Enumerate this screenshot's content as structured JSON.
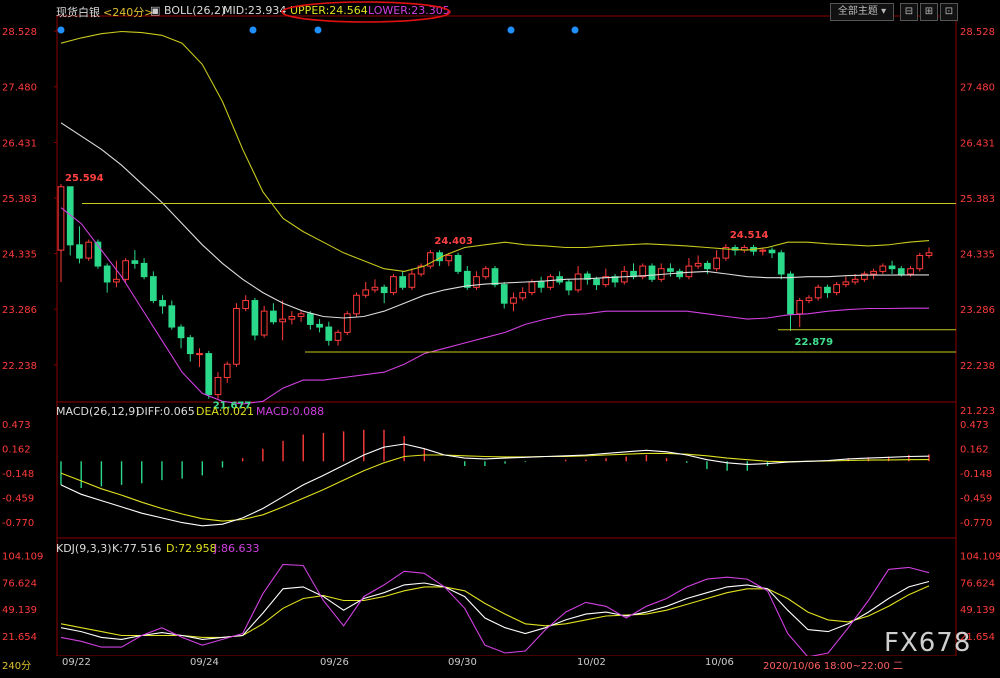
{
  "header": {
    "symbol": "现货白银",
    "period": "<240分>",
    "indicator": "BOLL(26,2)",
    "mid": "MID:23.934",
    "upper": "UPPER:24.564",
    "lower": "LOWER:23.305",
    "theme_button": "全部主题",
    "period_bottom": "240分"
  },
  "colors": {
    "candle_up": "#ff3b3b",
    "candle_down": "#2bd98a",
    "boll_upper": "#c8c81e",
    "boll_mid": "#dddddd",
    "boll_lower": "#d040e0",
    "dea": "#e0e020",
    "diff": "#ffffff",
    "macd_label": "#d040e0",
    "k": "#ffffff",
    "d": "#e0e020",
    "j": "#d040e0",
    "annotation_high": "#ff4040",
    "annotation_low": "#40e090"
  },
  "price_axis": {
    "ticks": [
      "28.528",
      "27.480",
      "26.431",
      "25.383",
      "24.335",
      "23.286",
      "22.238"
    ]
  },
  "macd_panel": {
    "title": "MACD(26,12,9)",
    "diff_label": "DIFF:0.065",
    "dea_label": "DEA:0.021",
    "macd_label": "MACD:0.088",
    "top_right": "21.223",
    "ticks": [
      "0.473",
      "0.162",
      "-0.148",
      "-0.459",
      "-0.770"
    ]
  },
  "kdj_panel": {
    "title": "KDJ(9,3,3)",
    "k_label": "K:77.516",
    "d_label": "D:72.958",
    "j_label": "J:86.633",
    "ticks": [
      "104.109",
      "76.624",
      "49.139",
      "21.654"
    ]
  },
  "date_axis": {
    "labels": [
      "09/22",
      "09/24",
      "09/26",
      "09/30",
      "10/02",
      "10/06"
    ],
    "cursor_time": "2020/10/06 18:00~22:00 二"
  },
  "watermark": "FX678",
  "chart_data": {
    "type": "candlestick",
    "title": "",
    "ylim": [
      21.5,
      28.7
    ],
    "annotations": [
      {
        "text": "25.594",
        "value": 25.594
      },
      {
        "text": "21.677",
        "value": 21.677
      },
      {
        "text": "24.403",
        "value": 24.403
      },
      {
        "text": "24.514",
        "value": 24.514
      },
      {
        "text": "22.879",
        "value": 22.879
      }
    ],
    "horizontal_lines": [
      25.28,
      22.48,
      22.9
    ],
    "candles": [
      [
        24.4,
        25.594,
        25.65,
        23.8
      ],
      [
        25.594,
        24.5,
        25.6,
        24.3
      ],
      [
        24.5,
        24.25,
        24.85,
        24.15
      ],
      [
        24.25,
        24.55,
        24.6,
        24.2
      ],
      [
        24.55,
        24.1,
        24.6,
        24.05
      ],
      [
        24.1,
        23.8,
        24.15,
        23.6
      ],
      [
        23.8,
        23.85,
        24.2,
        23.7
      ],
      [
        23.85,
        24.2,
        24.25,
        23.8
      ],
      [
        24.2,
        24.15,
        24.4,
        24.05
      ],
      [
        24.15,
        23.9,
        24.25,
        23.85
      ],
      [
        23.9,
        23.45,
        24.0,
        23.4
      ],
      [
        23.45,
        23.35,
        23.55,
        23.2
      ],
      [
        23.35,
        22.95,
        23.45,
        22.9
      ],
      [
        22.95,
        22.75,
        23.0,
        22.55
      ],
      [
        22.75,
        22.45,
        22.8,
        22.3
      ],
      [
        22.45,
        22.45,
        22.55,
        22.2
      ],
      [
        22.45,
        21.677,
        22.5,
        21.6
      ],
      [
        21.677,
        22.0,
        22.1,
        21.6
      ],
      [
        22.0,
        22.25,
        22.3,
        21.9
      ],
      [
        22.25,
        23.3,
        23.4,
        22.2
      ],
      [
        23.3,
        23.45,
        23.55,
        23.25
      ],
      [
        23.45,
        22.8,
        23.5,
        22.7
      ],
      [
        22.8,
        23.25,
        23.35,
        22.75
      ],
      [
        23.25,
        23.05,
        23.4,
        23.0
      ],
      [
        23.05,
        23.1,
        23.45,
        22.7
      ],
      [
        23.1,
        23.15,
        23.25,
        23.0
      ],
      [
        23.15,
        23.2,
        23.25,
        23.05
      ],
      [
        23.2,
        23.0,
        23.25,
        22.9
      ],
      [
        23.0,
        22.95,
        23.1,
        22.85
      ],
      [
        22.95,
        22.7,
        23.05,
        22.6
      ],
      [
        22.7,
        22.85,
        22.9,
        22.6
      ],
      [
        22.85,
        23.2,
        23.25,
        22.8
      ],
      [
        23.2,
        23.55,
        23.6,
        23.15
      ],
      [
        23.55,
        23.65,
        23.8,
        23.5
      ],
      [
        23.65,
        23.7,
        23.85,
        23.6
      ],
      [
        23.7,
        23.6,
        23.75,
        23.4
      ],
      [
        23.6,
        23.9,
        23.95,
        23.55
      ],
      [
        23.9,
        23.7,
        24.0,
        23.65
      ],
      [
        23.7,
        23.95,
        24.05,
        23.65
      ],
      [
        23.95,
        24.1,
        24.15,
        23.9
      ],
      [
        24.1,
        24.35,
        24.403,
        24.05
      ],
      [
        24.35,
        24.2,
        24.4,
        24.1
      ],
      [
        24.2,
        24.3,
        24.35,
        24.1
      ],
      [
        24.3,
        24.0,
        24.35,
        23.95
      ],
      [
        24.0,
        23.7,
        24.1,
        23.65
      ],
      [
        23.7,
        23.9,
        24.0,
        23.65
      ],
      [
        23.9,
        24.05,
        24.1,
        23.85
      ],
      [
        24.05,
        23.75,
        24.1,
        23.7
      ],
      [
        23.75,
        23.4,
        23.8,
        23.3
      ],
      [
        23.4,
        23.5,
        23.6,
        23.25
      ],
      [
        23.5,
        23.6,
        23.7,
        23.45
      ],
      [
        23.6,
        23.8,
        23.85,
        23.55
      ],
      [
        23.8,
        23.7,
        23.9,
        23.6
      ],
      [
        23.7,
        23.9,
        23.95,
        23.65
      ],
      [
        23.9,
        23.8,
        24.0,
        23.75
      ],
      [
        23.8,
        23.65,
        23.85,
        23.55
      ],
      [
        23.65,
        23.95,
        24.1,
        23.6
      ],
      [
        23.95,
        23.85,
        24.0,
        23.75
      ],
      [
        23.85,
        23.75,
        23.9,
        23.65
      ],
      [
        23.75,
        23.9,
        24.05,
        23.7
      ],
      [
        23.9,
        23.8,
        23.95,
        23.7
      ],
      [
        23.8,
        24.0,
        24.1,
        23.75
      ],
      [
        24.0,
        23.9,
        24.15,
        23.85
      ],
      [
        23.9,
        24.1,
        24.15,
        23.85
      ],
      [
        24.1,
        23.85,
        24.15,
        23.8
      ],
      [
        23.85,
        24.05,
        24.15,
        23.8
      ],
      [
        24.05,
        24.0,
        24.15,
        23.9
      ],
      [
        24.0,
        23.9,
        24.05,
        23.85
      ],
      [
        23.9,
        24.1,
        24.25,
        23.85
      ],
      [
        24.1,
        24.15,
        24.3,
        24.05
      ],
      [
        24.15,
        24.05,
        24.2,
        23.95
      ],
      [
        24.05,
        24.25,
        24.4,
        24.0
      ],
      [
        24.25,
        24.45,
        24.514,
        24.2
      ],
      [
        24.45,
        24.4,
        24.5,
        24.3
      ],
      [
        24.4,
        24.45,
        24.5,
        24.35
      ],
      [
        24.45,
        24.38,
        24.5,
        24.3
      ],
      [
        24.38,
        24.4,
        24.45,
        24.3
      ],
      [
        24.4,
        24.35,
        24.45,
        24.25
      ],
      [
        24.35,
        23.95,
        24.4,
        23.85
      ],
      [
        23.95,
        23.2,
        24.0,
        22.879
      ],
      [
        23.2,
        23.45,
        23.5,
        22.95
      ],
      [
        23.45,
        23.5,
        23.55,
        23.4
      ],
      [
        23.5,
        23.7,
        23.75,
        23.45
      ],
      [
        23.7,
        23.6,
        23.75,
        23.5
      ],
      [
        23.6,
        23.75,
        23.8,
        23.55
      ],
      [
        23.75,
        23.8,
        23.9,
        23.7
      ],
      [
        23.8,
        23.85,
        23.95,
        23.75
      ],
      [
        23.85,
        23.95,
        24.0,
        23.8
      ],
      [
        23.95,
        24.0,
        24.05,
        23.85
      ],
      [
        24.0,
        24.1,
        24.15,
        23.95
      ],
      [
        24.1,
        24.05,
        24.2,
        23.95
      ],
      [
        24.05,
        23.95,
        24.1,
        23.9
      ],
      [
        23.95,
        24.05,
        24.1,
        23.9
      ],
      [
        24.05,
        24.3,
        24.35,
        24.0
      ],
      [
        24.3,
        24.35,
        24.45,
        24.25
      ]
    ],
    "boll_upper": [
      28.3,
      28.4,
      28.48,
      28.52,
      28.5,
      28.45,
      28.3,
      27.9,
      27.2,
      26.3,
      25.5,
      25.0,
      24.75,
      24.55,
      24.35,
      24.2,
      24.05,
      24.0,
      24.1,
      24.3,
      24.45,
      24.5,
      24.55,
      24.5,
      24.48,
      24.45,
      24.45,
      24.48,
      24.5,
      24.52,
      24.5,
      24.48,
      24.45,
      24.42,
      24.4,
      24.45,
      24.55,
      24.55,
      24.52,
      24.5,
      24.48,
      24.5,
      24.55,
      24.58
    ],
    "boll_mid": [
      26.8,
      26.55,
      26.3,
      26.0,
      25.65,
      25.3,
      24.9,
      24.5,
      24.15,
      23.85,
      23.6,
      23.4,
      23.25,
      23.15,
      23.12,
      23.15,
      23.25,
      23.4,
      23.55,
      23.65,
      23.72,
      23.76,
      23.78,
      23.8,
      23.82,
      23.85,
      23.86,
      23.88,
      23.9,
      23.92,
      23.95,
      23.98,
      24.0,
      23.95,
      23.9,
      23.88,
      23.88,
      23.9,
      23.9,
      23.92,
      23.93,
      23.93,
      23.934,
      23.934
    ],
    "boll_lower": [
      25.2,
      24.9,
      24.4,
      23.9,
      23.3,
      22.7,
      22.1,
      21.7,
      21.55,
      21.5,
      21.55,
      21.8,
      21.95,
      21.95,
      22.0,
      22.05,
      22.1,
      22.25,
      22.45,
      22.55,
      22.65,
      22.75,
      22.85,
      23.0,
      23.1,
      23.18,
      23.2,
      23.25,
      23.25,
      23.25,
      23.25,
      23.25,
      23.2,
      23.15,
      23.1,
      23.12,
      23.18,
      23.2,
      23.25,
      23.28,
      23.3,
      23.3,
      23.305,
      23.305
    ],
    "macd": {
      "ylim": [
        -0.95,
        0.55
      ],
      "diff": [
        -0.3,
        -0.42,
        -0.5,
        -0.58,
        -0.66,
        -0.72,
        -0.78,
        -0.82,
        -0.8,
        -0.72,
        -0.6,
        -0.45,
        -0.3,
        -0.18,
        -0.05,
        0.08,
        0.18,
        0.22,
        0.16,
        0.08,
        0.04,
        0.03,
        0.04,
        0.05,
        0.06,
        0.07,
        0.08,
        0.1,
        0.12,
        0.14,
        0.12,
        0.08,
        0.02,
        -0.02,
        -0.04,
        -0.03,
        -0.01,
        0.0,
        0.01,
        0.03,
        0.04,
        0.05,
        0.06,
        0.065
      ],
      "dea": [
        -0.15,
        -0.25,
        -0.35,
        -0.43,
        -0.52,
        -0.6,
        -0.67,
        -0.73,
        -0.76,
        -0.74,
        -0.68,
        -0.58,
        -0.47,
        -0.36,
        -0.24,
        -0.12,
        -0.02,
        0.06,
        0.08,
        0.08,
        0.07,
        0.06,
        0.055,
        0.055,
        0.06,
        0.06,
        0.07,
        0.08,
        0.09,
        0.1,
        0.1,
        0.09,
        0.07,
        0.04,
        0.02,
        0.0,
        -0.005,
        0.0,
        0.005,
        0.01,
        0.015,
        0.018,
        0.02,
        0.021
      ],
      "hist": [
        -0.3,
        -0.34,
        -0.32,
        -0.3,
        -0.28,
        -0.24,
        -0.22,
        -0.18,
        -0.08,
        0.04,
        0.16,
        0.26,
        0.34,
        0.36,
        0.38,
        0.4,
        0.4,
        0.32,
        0.16,
        0.0,
        -0.06,
        -0.06,
        -0.03,
        -0.01,
        0.0,
        0.02,
        0.02,
        0.04,
        0.06,
        0.08,
        0.04,
        -0.02,
        -0.1,
        -0.12,
        -0.12,
        -0.06,
        -0.01,
        0.0,
        0.01,
        0.04,
        0.05,
        0.06,
        0.08,
        0.088
      ]
    },
    "kdj": {
      "ylim": [
        5,
        112
      ],
      "k": [
        30,
        26,
        20,
        18,
        22,
        25,
        22,
        18,
        20,
        22,
        45,
        70,
        72,
        62,
        48,
        60,
        66,
        74,
        76,
        72,
        62,
        40,
        30,
        24,
        30,
        38,
        44,
        46,
        42,
        46,
        52,
        60,
        66,
        72,
        74,
        70,
        48,
        28,
        26,
        34,
        46,
        60,
        72,
        77.5
      ],
      "d": [
        34,
        30,
        26,
        22,
        22,
        22,
        22,
        20,
        20,
        22,
        34,
        50,
        60,
        63,
        58,
        58,
        62,
        68,
        72,
        72,
        68,
        55,
        44,
        34,
        32,
        34,
        38,
        42,
        43,
        44,
        48,
        54,
        60,
        66,
        70,
        70,
        60,
        46,
        38,
        36,
        42,
        52,
        64,
        72.96
      ],
      "j": [
        20,
        16,
        10,
        10,
        22,
        30,
        20,
        12,
        18,
        24,
        65,
        95,
        94,
        58,
        32,
        62,
        74,
        88,
        86,
        72,
        50,
        12,
        4,
        6,
        28,
        46,
        56,
        52,
        40,
        52,
        60,
        72,
        80,
        82,
        80,
        68,
        24,
        0,
        4,
        30,
        58,
        90,
        92,
        86.6
      ]
    }
  }
}
